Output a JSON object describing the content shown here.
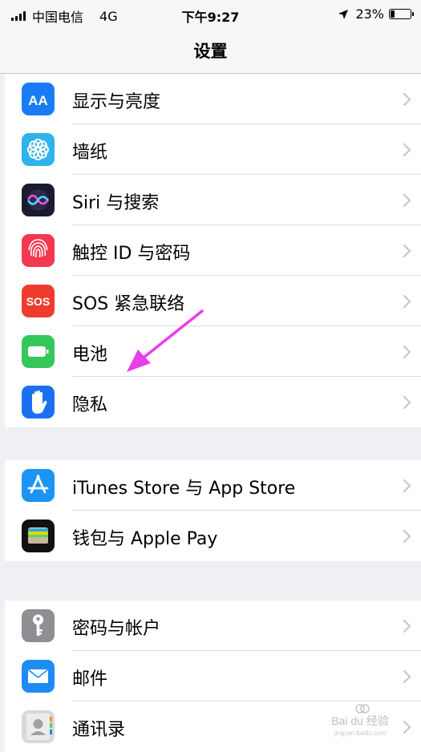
{
  "status_bar": {
    "carrier": "中国电信",
    "network": "4G",
    "time": "下午9:27",
    "battery_percent": "23%",
    "battery_level": 0.23
  },
  "nav": {
    "title": "设置"
  },
  "groups": [
    {
      "items": [
        {
          "label": "显示与亮度",
          "icon": "display-brightness-icon",
          "color": "#1a7cf5"
        },
        {
          "label": "墙纸",
          "icon": "wallpaper-flower-icon",
          "color": "#2eb3eb"
        },
        {
          "label": "Siri 与搜索",
          "icon": "siri-icon",
          "color": "#1b1b2f"
        },
        {
          "label": "触控 ID 与密码",
          "icon": "fingerprint-icon",
          "color": "#f2394f"
        },
        {
          "label": "SOS 紧急联络",
          "icon": "sos-icon",
          "color": "#f03c2f",
          "icon_text": "SOS"
        },
        {
          "label": "电池",
          "icon": "battery-icon",
          "color": "#36c759"
        },
        {
          "label": "隐私",
          "icon": "hand-privacy-icon",
          "color": "#1d6ff2"
        }
      ]
    },
    {
      "items": [
        {
          "label": "iTunes Store 与 App Store",
          "icon": "app-store-icon",
          "color": "#1b95f5"
        },
        {
          "label": "钱包与 Apple Pay",
          "icon": "wallet-icon",
          "color": "#111111"
        }
      ]
    },
    {
      "items": [
        {
          "label": "密码与帐户",
          "icon": "key-icon",
          "color": "#8e8e93"
        },
        {
          "label": "邮件",
          "icon": "mail-icon",
          "color": "#1c8cf2"
        },
        {
          "label": "通讯录",
          "icon": "contacts-icon",
          "color": "#d8d8dc"
        }
      ]
    }
  ],
  "annotation": {
    "color": "#e83ee8"
  },
  "watermark": {
    "text": "Bai du 经验",
    "subtext": "jingyan.baidu.com"
  }
}
